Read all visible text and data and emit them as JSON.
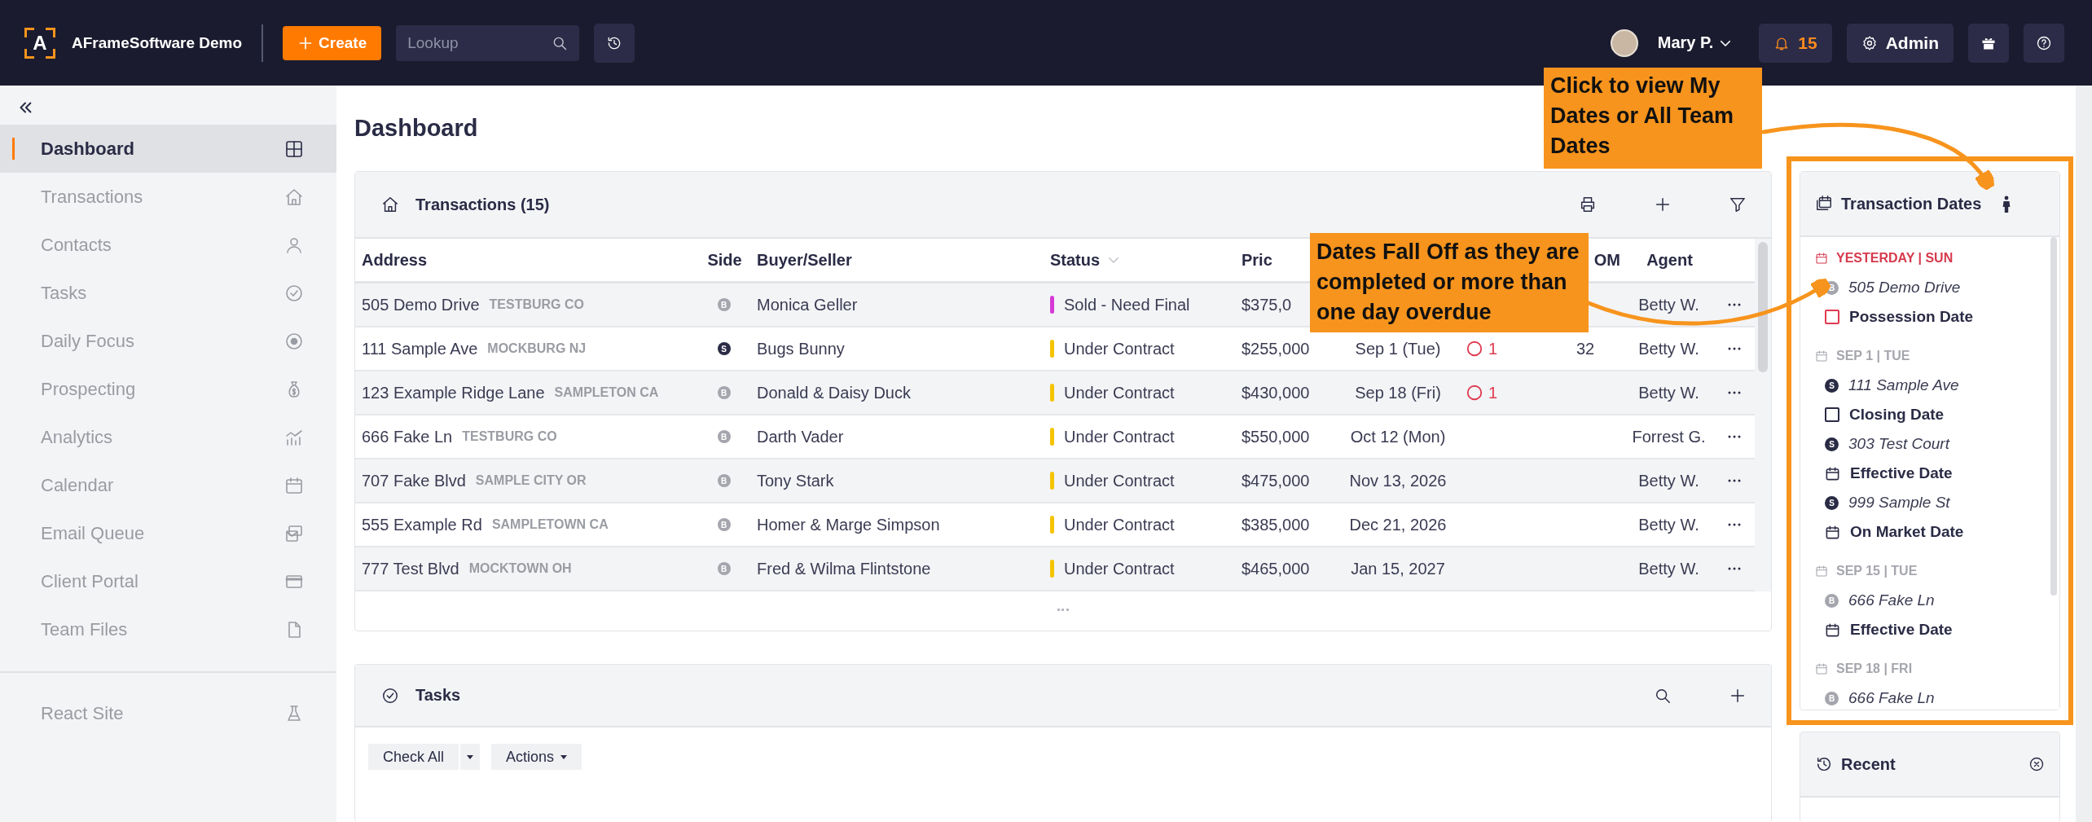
{
  "top_bar": {
    "logo_letter": "A",
    "app_name": "AFrameSoftware Demo",
    "create_label": "Create",
    "lookup_placeholder": "Lookup",
    "user_name": "Mary P.",
    "notification_count": "15",
    "admin_label": "Admin"
  },
  "sidebar": {
    "items": [
      {
        "label": "Dashboard",
        "selected": true
      },
      {
        "label": "Transactions",
        "selected": false
      },
      {
        "label": "Contacts",
        "selected": false
      },
      {
        "label": "Tasks",
        "selected": false
      },
      {
        "label": "Daily Focus",
        "selected": false
      },
      {
        "label": "Prospecting",
        "selected": false
      },
      {
        "label": "Analytics",
        "selected": false
      },
      {
        "label": "Calendar",
        "selected": false
      },
      {
        "label": "Email Queue",
        "selected": false
      },
      {
        "label": "Client Portal",
        "selected": false
      },
      {
        "label": "Team Files",
        "selected": false
      }
    ],
    "footer_items": [
      {
        "label": "React Site",
        "selected": false
      }
    ]
  },
  "page_title": "Dashboard",
  "transactions": {
    "title": "Transactions (15)",
    "columns": [
      {
        "label": "Address",
        "sort_indicator": false
      },
      {
        "label": "Side",
        "sort_indicator": false
      },
      {
        "label": "Buyer/Seller",
        "sort_indicator": false
      },
      {
        "label": "Status",
        "sort_indicator": true
      },
      {
        "label": "Pric",
        "sort_indicator": false
      },
      {
        "label": "OM",
        "sort_indicator": false
      },
      {
        "label": "Agent",
        "sort_indicator": false
      }
    ],
    "rows": [
      {
        "address": "505 Demo Drive",
        "city": "TESTBURG CO",
        "side": "B",
        "party": "Monica Geller",
        "status": "Sold - Need Final",
        "color": "#d63ad6",
        "price": "$375,0",
        "agent": "Betty W."
      },
      {
        "address": "111 Sample Ave",
        "city": "MOCKBURG NJ",
        "side": "S",
        "party": "Bugs Bunny",
        "status": "Under Contract",
        "color": "#f5c400",
        "price": "$255,000",
        "date": "Sep 1 (Tue)",
        "tasks": "1",
        "dom": "32",
        "agent": "Betty W."
      },
      {
        "address": "123 Example Ridge Lane",
        "city": "SAMPLETON CA",
        "side": "B",
        "party": "Donald & Daisy Duck",
        "status": "Under Contract",
        "color": "#f5c400",
        "price": "$430,000",
        "date": "Sep 18 (Fri)",
        "tasks": "1",
        "agent": "Betty W."
      },
      {
        "address": "666 Fake Ln",
        "city": "TESTBURG CO",
        "side": "B",
        "party": "Darth Vader",
        "status": "Under Contract",
        "color": "#f5c400",
        "price": "$550,000",
        "date": "Oct 12 (Mon)",
        "agent": "Forrest G."
      },
      {
        "address": "707 Fake Blvd",
        "city": "SAMPLE CITY OR",
        "side": "B",
        "party": "Tony Stark",
        "status": "Under Contract",
        "color": "#f5c400",
        "price": "$475,000",
        "date": "Nov 13, 2026",
        "agent": "Betty W."
      },
      {
        "address": "555 Example Rd",
        "city": "SAMPLETOWN CA",
        "side": "B",
        "party": "Homer & Marge Simpson",
        "status": "Under Contract",
        "color": "#f5c400",
        "price": "$385,000",
        "date": "Dec 21, 2026",
        "agent": "Betty W."
      },
      {
        "address": "777 Test Blvd",
        "city": "MOCKTOWN OH",
        "side": "B",
        "party": "Fred & Wilma Flintstone",
        "status": "Under Contract",
        "color": "#f5c400",
        "price": "$465,000",
        "date": "Jan 15, 2027",
        "agent": "Betty W."
      }
    ]
  },
  "tasks_panel": {
    "title": "Tasks",
    "buttons": [
      {
        "label": "Check All",
        "kind": "split"
      },
      {
        "label": "Actions",
        "kind": "dropdown"
      }
    ]
  },
  "transaction_dates": {
    "title": "Transaction Dates",
    "groups": [
      {
        "label": "YESTERDAY | SUN",
        "overdue": true,
        "entries": [
          {
            "kind": "address",
            "side": "B",
            "text": "505 Demo Drive"
          },
          {
            "kind": "task",
            "overdue": true,
            "text": "Possession Date"
          }
        ]
      },
      {
        "label": "SEP 1 | TUE",
        "overdue": false,
        "entries": [
          {
            "kind": "address",
            "side": "S",
            "text": "111 Sample Ave"
          },
          {
            "kind": "task",
            "overdue": false,
            "text": "Closing Date"
          },
          {
            "kind": "address",
            "side": "S",
            "text": "303 Test Court"
          },
          {
            "kind": "event",
            "overdue": false,
            "text": "Effective Date"
          },
          {
            "kind": "address",
            "side": "S",
            "text": "999 Sample St"
          },
          {
            "kind": "event",
            "overdue": false,
            "text": "On Market Date"
          }
        ]
      },
      {
        "label": "SEP 15 | TUE",
        "overdue": false,
        "entries": [
          {
            "kind": "address",
            "side": "B",
            "text": "666 Fake Ln"
          },
          {
            "kind": "event",
            "overdue": false,
            "text": "Effective Date"
          }
        ]
      },
      {
        "label": "SEP 18 | FRI",
        "overdue": false,
        "entries": [
          {
            "kind": "address",
            "side": "B",
            "text": "666 Fake Ln"
          }
        ]
      }
    ]
  },
  "recent": {
    "title": "Recent"
  },
  "annotations": [
    {
      "text": "Click to view My Dates or All Team Dates"
    },
    {
      "text": "Dates Fall Off as they are completed or more than one day overdue"
    }
  ]
}
